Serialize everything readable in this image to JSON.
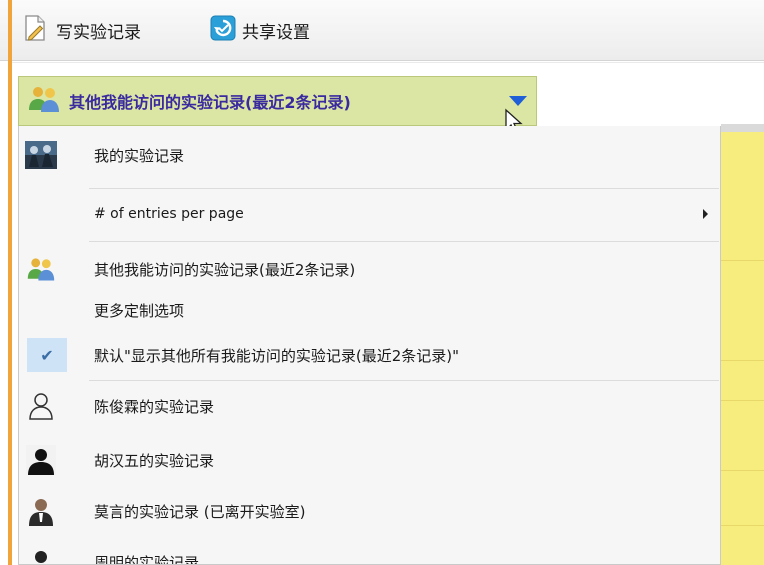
{
  "toolbar": {
    "write_label": "写实验记录",
    "write_icon": "document-pen-icon",
    "share_label": "共享设置",
    "share_icon": "share-icon"
  },
  "selector": {
    "label": "其他我能访问的实验记录(最近2条记录)",
    "icon": "people-icon"
  },
  "menu": {
    "my_records": "我的实验记录",
    "entries_per_page": "# of entries per page",
    "others": "其他我能访问的实验记录(最近2条记录)",
    "more_options": "更多定制选项",
    "default_option": "默认\"显示其他所有我能访问的实验记录(最近2条记录)\"",
    "users": [
      {
        "label": "陈俊霖的实验记录",
        "icon": "user-outline-icon"
      },
      {
        "label": "胡汉五的实验记录",
        "icon": "user-silhouette-icon"
      },
      {
        "label": "莫言的实验记录 (已离开实验室)",
        "icon": "user-photo-icon"
      },
      {
        "label": "周明的实验记录",
        "icon": "user-silhouette-icon"
      }
    ]
  },
  "colors": {
    "selector_bg": "#dbe6a5",
    "selector_text": "#3a2aa0",
    "accent_blue": "#1f5fd8",
    "check_bg": "#cfe3f6",
    "side_yellow": "#f7ed7f",
    "side_orange": "#f1a43a"
  }
}
